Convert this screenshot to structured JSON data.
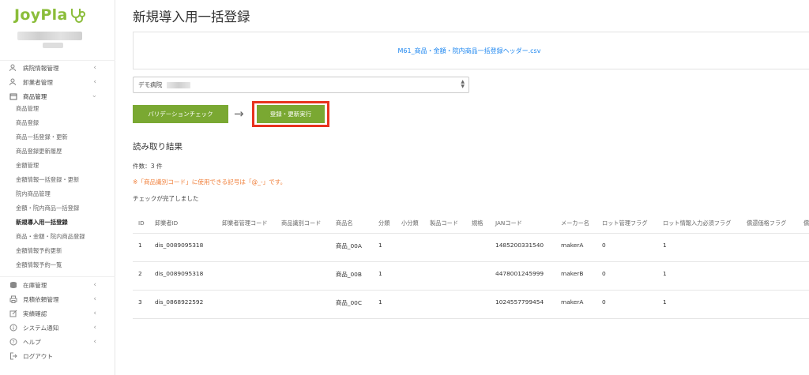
{
  "app": {
    "logo": "JoyPla"
  },
  "sidebar": {
    "menu": [
      {
        "label": "病院情報管理",
        "icon": "users-icon"
      },
      {
        "label": "卸業者管理",
        "icon": "users-icon"
      },
      {
        "label": "商品管理",
        "icon": "box-icon"
      }
    ],
    "product_submenu": [
      "商品管理",
      "商品登録",
      "商品一括登録・更新",
      "商品登録更新履歴",
      "金額管理",
      "金額情報一括登録・更新",
      "院内商品管理",
      "金額・院内商品一括登録",
      "新規導入用一括登録",
      "商品・金額・院内商品登録",
      "金額情報予約更新",
      "金額情報予約一覧"
    ],
    "bottom_menu": [
      {
        "label": "在庫管理",
        "icon": "database-icon"
      },
      {
        "label": "見積依頼管理",
        "icon": "print-icon"
      },
      {
        "label": "実績確認",
        "icon": "edit-icon"
      },
      {
        "label": "システム通知",
        "icon": "info-icon"
      },
      {
        "label": "ヘルプ",
        "icon": "question-icon"
      },
      {
        "label": "ログアウト",
        "icon": "logout-icon"
      }
    ]
  },
  "main": {
    "title": "新規導入用一括登録",
    "file_name": "M61_商品・金額・院内商品一括登録ヘッダー.csv",
    "hospital_select": "デモ病院",
    "validate_label": "バリデーションチェック",
    "execute_label": "登録・更新実行",
    "results_title": "読み取り結果",
    "count": "件数：3 件",
    "notice": "※「商品識別コード」に使用できる記号は「@_-」です。",
    "complete": "チェックが完了しました"
  },
  "table": {
    "headers": [
      "ID",
      "卸業者ID",
      "卸業者管理コード",
      "商品識別コード",
      "商品名",
      "分類",
      "小分類",
      "製品コード",
      "規格",
      "JANコード",
      "メーカー名",
      "ロット管理フラグ",
      "ロット情報入力必須フラグ",
      "償還価格フラグ",
      "償"
    ],
    "rows": [
      [
        "1",
        "dis_0089095318",
        "",
        "",
        "商品_00A",
        "1",
        "",
        "",
        "",
        "1485200331540",
        "makerA",
        "0",
        "1",
        "",
        ""
      ],
      [
        "2",
        "dis_0089095318",
        "",
        "",
        "商品_00B",
        "1",
        "",
        "",
        "",
        "4478001245999",
        "makerB",
        "0",
        "1",
        "",
        ""
      ],
      [
        "3",
        "dis_0868922592",
        "",
        "",
        "商品_00C",
        "1",
        "",
        "",
        "",
        "1024557799454",
        "makerA",
        "0",
        "1",
        "",
        ""
      ]
    ]
  },
  "colors": {
    "accent_green": "#7aa832",
    "highlight_red": "#e8331e",
    "link_blue": "#1e87f0",
    "notice_orange": "#f0803c"
  }
}
